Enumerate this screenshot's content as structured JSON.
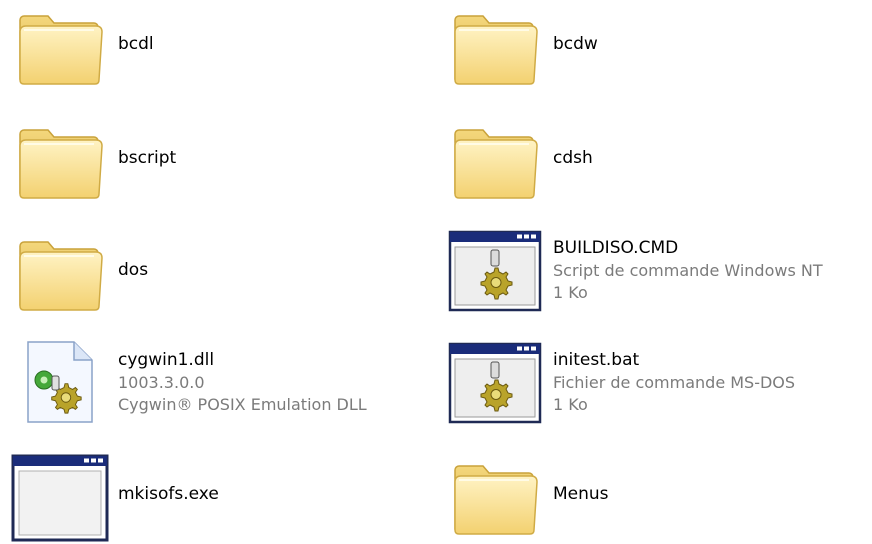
{
  "colors": {
    "folder_light": "#fde9a8",
    "folder_dark": "#e7c25a",
    "folder_edge": "#c9a23a",
    "window_title": "#1a2c7a",
    "window_frame": "#1f2a55",
    "detail_text": "#7b7b7b",
    "gear": "#b8a328"
  },
  "items": [
    {
      "icon": "folder-icon",
      "name": "bcdl",
      "details": []
    },
    {
      "icon": "folder-icon",
      "name": "bcdw",
      "details": []
    },
    {
      "icon": "folder-icon",
      "name": "bscript",
      "details": []
    },
    {
      "icon": "folder-icon",
      "name": "cdsh",
      "details": []
    },
    {
      "icon": "folder-icon",
      "name": "dos",
      "details": []
    },
    {
      "icon": "batch-file-icon",
      "name": "BUILDISO.CMD",
      "details": [
        "Script de commande Windows NT",
        "1 Ko"
      ]
    },
    {
      "icon": "dll-file-icon",
      "name": "cygwin1.dll",
      "details": [
        "1003.3.0.0",
        "Cygwin® POSIX Emulation DLL"
      ]
    },
    {
      "icon": "batch-file-icon",
      "name": "initest.bat",
      "details": [
        "Fichier de commande MS-DOS",
        "1 Ko"
      ]
    },
    {
      "icon": "application-icon",
      "name": "mkisofs.exe",
      "details": []
    },
    {
      "icon": "folder-icon",
      "name": "Menus",
      "details": []
    }
  ]
}
